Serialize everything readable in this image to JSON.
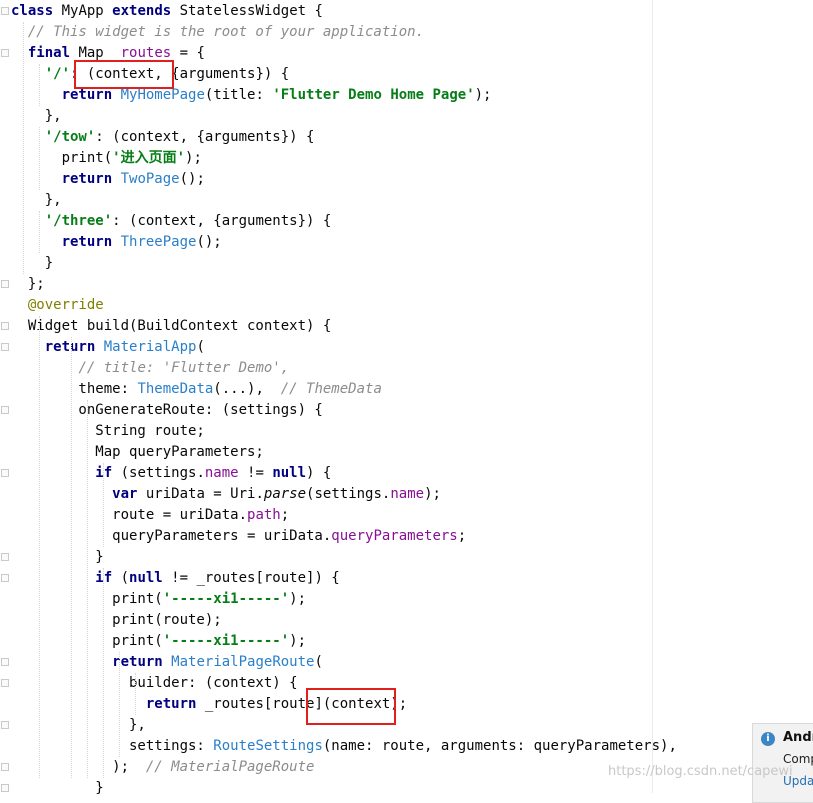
{
  "code_lines": [
    "class MyApp extends StatelessWidget {",
    "  // This widget is the root of your application.",
    "  final Map _routes = {",
    "    '/': (context, {arguments}) {",
    "      return MyHomePage(title: 'Flutter Demo Home Page');",
    "    },",
    "    '/tow': (context, {arguments}) {",
    "      print('进入页面');",
    "      return TwoPage();",
    "    },",
    "    '/three': (context, {arguments}) {",
    "      return ThreePage();",
    "    }",
    "  };",
    "  @override",
    "  Widget build(BuildContext context) {",
    "    return MaterialApp(",
    "        // title: 'Flutter Demo',",
    "        theme: ThemeData(...),  // ThemeData",
    "        onGenerateRoute: (settings) {",
    "          String route;",
    "          Map queryParameters;",
    "          if (settings.name != null) {",
    "            var uriData = Uri.parse(settings.name);",
    "            route = uriData.path;",
    "            queryParameters = uriData.queryParameters;",
    "          }",
    "          if (null != _routes[route]) {",
    "            print('-----xi1-----');",
    "            print(route);",
    "            print('-----xi1-----');",
    "            return MaterialPageRoute(",
    "              builder: (context) {",
    "                return _routes[route](context);",
    "              },",
    "              settings: RouteSettings(name: route, arguments: queryParameters),",
    "            );  // MaterialPageRoute",
    "          }"
  ],
  "notification": {
    "icon": "info-icon",
    "title": "Andro",
    "body": "Comp",
    "link": "Upda"
  },
  "watermark": "https://blog.csdn.net/capewi",
  "colors": {
    "keyword": "#000080",
    "string": "#067d17",
    "comment": "#8c8c8c",
    "class_ref": "#2a7fc9",
    "field": "#871094",
    "annotation": "#808000",
    "highlight_box": "#e0201c"
  }
}
